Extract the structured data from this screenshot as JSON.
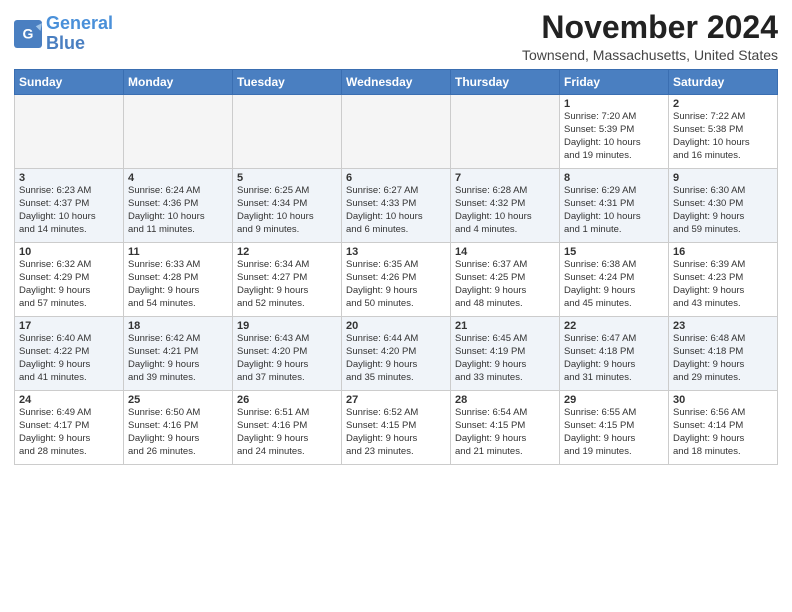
{
  "header": {
    "logo_line1": "General",
    "logo_line2": "Blue",
    "month": "November 2024",
    "location": "Townsend, Massachusetts, United States"
  },
  "weekdays": [
    "Sunday",
    "Monday",
    "Tuesday",
    "Wednesday",
    "Thursday",
    "Friday",
    "Saturday"
  ],
  "weeks": [
    [
      {
        "day": "",
        "info": ""
      },
      {
        "day": "",
        "info": ""
      },
      {
        "day": "",
        "info": ""
      },
      {
        "day": "",
        "info": ""
      },
      {
        "day": "",
        "info": ""
      },
      {
        "day": "1",
        "info": "Sunrise: 7:20 AM\nSunset: 5:39 PM\nDaylight: 10 hours\nand 19 minutes."
      },
      {
        "day": "2",
        "info": "Sunrise: 7:22 AM\nSunset: 5:38 PM\nDaylight: 10 hours\nand 16 minutes."
      }
    ],
    [
      {
        "day": "3",
        "info": "Sunrise: 6:23 AM\nSunset: 4:37 PM\nDaylight: 10 hours\nand 14 minutes."
      },
      {
        "day": "4",
        "info": "Sunrise: 6:24 AM\nSunset: 4:36 PM\nDaylight: 10 hours\nand 11 minutes."
      },
      {
        "day": "5",
        "info": "Sunrise: 6:25 AM\nSunset: 4:34 PM\nDaylight: 10 hours\nand 9 minutes."
      },
      {
        "day": "6",
        "info": "Sunrise: 6:27 AM\nSunset: 4:33 PM\nDaylight: 10 hours\nand 6 minutes."
      },
      {
        "day": "7",
        "info": "Sunrise: 6:28 AM\nSunset: 4:32 PM\nDaylight: 10 hours\nand 4 minutes."
      },
      {
        "day": "8",
        "info": "Sunrise: 6:29 AM\nSunset: 4:31 PM\nDaylight: 10 hours\nand 1 minute."
      },
      {
        "day": "9",
        "info": "Sunrise: 6:30 AM\nSunset: 4:30 PM\nDaylight: 9 hours\nand 59 minutes."
      }
    ],
    [
      {
        "day": "10",
        "info": "Sunrise: 6:32 AM\nSunset: 4:29 PM\nDaylight: 9 hours\nand 57 minutes."
      },
      {
        "day": "11",
        "info": "Sunrise: 6:33 AM\nSunset: 4:28 PM\nDaylight: 9 hours\nand 54 minutes."
      },
      {
        "day": "12",
        "info": "Sunrise: 6:34 AM\nSunset: 4:27 PM\nDaylight: 9 hours\nand 52 minutes."
      },
      {
        "day": "13",
        "info": "Sunrise: 6:35 AM\nSunset: 4:26 PM\nDaylight: 9 hours\nand 50 minutes."
      },
      {
        "day": "14",
        "info": "Sunrise: 6:37 AM\nSunset: 4:25 PM\nDaylight: 9 hours\nand 48 minutes."
      },
      {
        "day": "15",
        "info": "Sunrise: 6:38 AM\nSunset: 4:24 PM\nDaylight: 9 hours\nand 45 minutes."
      },
      {
        "day": "16",
        "info": "Sunrise: 6:39 AM\nSunset: 4:23 PM\nDaylight: 9 hours\nand 43 minutes."
      }
    ],
    [
      {
        "day": "17",
        "info": "Sunrise: 6:40 AM\nSunset: 4:22 PM\nDaylight: 9 hours\nand 41 minutes."
      },
      {
        "day": "18",
        "info": "Sunrise: 6:42 AM\nSunset: 4:21 PM\nDaylight: 9 hours\nand 39 minutes."
      },
      {
        "day": "19",
        "info": "Sunrise: 6:43 AM\nSunset: 4:20 PM\nDaylight: 9 hours\nand 37 minutes."
      },
      {
        "day": "20",
        "info": "Sunrise: 6:44 AM\nSunset: 4:20 PM\nDaylight: 9 hours\nand 35 minutes."
      },
      {
        "day": "21",
        "info": "Sunrise: 6:45 AM\nSunset: 4:19 PM\nDaylight: 9 hours\nand 33 minutes."
      },
      {
        "day": "22",
        "info": "Sunrise: 6:47 AM\nSunset: 4:18 PM\nDaylight: 9 hours\nand 31 minutes."
      },
      {
        "day": "23",
        "info": "Sunrise: 6:48 AM\nSunset: 4:18 PM\nDaylight: 9 hours\nand 29 minutes."
      }
    ],
    [
      {
        "day": "24",
        "info": "Sunrise: 6:49 AM\nSunset: 4:17 PM\nDaylight: 9 hours\nand 28 minutes."
      },
      {
        "day": "25",
        "info": "Sunrise: 6:50 AM\nSunset: 4:16 PM\nDaylight: 9 hours\nand 26 minutes."
      },
      {
        "day": "26",
        "info": "Sunrise: 6:51 AM\nSunset: 4:16 PM\nDaylight: 9 hours\nand 24 minutes."
      },
      {
        "day": "27",
        "info": "Sunrise: 6:52 AM\nSunset: 4:15 PM\nDaylight: 9 hours\nand 23 minutes."
      },
      {
        "day": "28",
        "info": "Sunrise: 6:54 AM\nSunset: 4:15 PM\nDaylight: 9 hours\nand 21 minutes."
      },
      {
        "day": "29",
        "info": "Sunrise: 6:55 AM\nSunset: 4:15 PM\nDaylight: 9 hours\nand 19 minutes."
      },
      {
        "day": "30",
        "info": "Sunrise: 6:56 AM\nSunset: 4:14 PM\nDaylight: 9 hours\nand 18 minutes."
      }
    ]
  ]
}
